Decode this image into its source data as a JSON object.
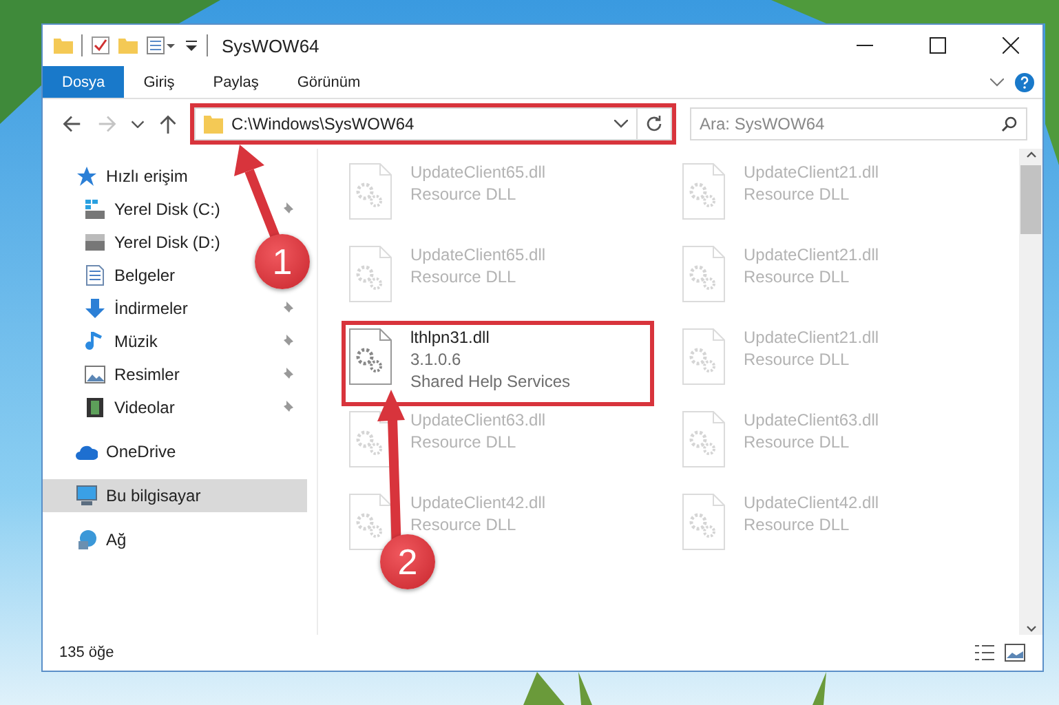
{
  "window": {
    "title": "SysWOW64"
  },
  "ribbon_tabs": [
    {
      "label": "Dosya",
      "selected": true
    },
    {
      "label": "Giriş",
      "selected": false
    },
    {
      "label": "Paylaş",
      "selected": false
    },
    {
      "label": "Görünüm",
      "selected": false
    }
  ],
  "nav_buttons": [
    {
      "kind": "back",
      "disabled": false
    },
    {
      "kind": "forward",
      "disabled": true
    },
    {
      "kind": "recent",
      "disabled": false
    },
    {
      "kind": "up",
      "disabled": false
    }
  ],
  "address_bar": {
    "value": "C:\\Windows\\SysWOW64",
    "highlighted": true
  },
  "search": {
    "placeholder": "Ara: SysWOW64"
  },
  "sidebar": {
    "items": [
      {
        "label": "Hızlı erişim",
        "kind": "quick",
        "selected": false,
        "children": [
          {
            "label": "Yerel Disk (C:)",
            "kind": "system-drive",
            "pinned": true,
            "selected": false
          },
          {
            "label": "Yerel Disk (D:)",
            "kind": "drive",
            "selected": false
          },
          {
            "label": "Belgeler",
            "kind": "documents",
            "selected": false
          },
          {
            "label": "İndirmeler",
            "kind": "downloads",
            "pinned": true,
            "selected": false
          },
          {
            "label": "Müzik",
            "kind": "music",
            "pinned": true,
            "selected": false
          },
          {
            "label": "Resimler",
            "kind": "pictures",
            "pinned": true,
            "selected": false
          },
          {
            "label": "Videolar",
            "kind": "videos",
            "pinned": true,
            "selected": false
          }
        ]
      },
      {
        "label": "OneDrive",
        "kind": "cloud",
        "selected": false
      },
      {
        "label": "Bu bilgisayar",
        "kind": "computer",
        "selected": true
      },
      {
        "label": "Ağ",
        "kind": "network",
        "selected": false
      }
    ]
  },
  "files": [
    {
      "name": "UpdateClient65.dll",
      "details": [
        "Resource DLL"
      ],
      "dimmed": true,
      "highlighted": false
    },
    {
      "name": "UpdateClient21.dll",
      "details": [
        "Resource DLL"
      ],
      "dimmed": true,
      "highlighted": false
    },
    {
      "name": "UpdateClient65.dll",
      "details": [
        "Resource DLL"
      ],
      "dimmed": true,
      "highlighted": false
    },
    {
      "name": "UpdateClient21.dll",
      "details": [
        "Resource DLL"
      ],
      "dimmed": true,
      "highlighted": false
    },
    {
      "name": "lthlpn31.dll",
      "details": [
        "3.1.0.6",
        "Shared Help Services"
      ],
      "dimmed": false,
      "highlighted": true
    },
    {
      "name": "UpdateClient21.dll",
      "details": [
        "Resource DLL"
      ],
      "dimmed": true,
      "highlighted": false
    },
    {
      "name": "UpdateClient63.dll",
      "details": [
        "Resource DLL"
      ],
      "dimmed": true,
      "highlighted": false
    },
    {
      "name": "UpdateClient63.dll",
      "details": [
        "Resource DLL"
      ],
      "dimmed": true,
      "highlighted": false
    },
    {
      "name": "UpdateClient42.dll",
      "details": [
        "Resource DLL"
      ],
      "dimmed": true,
      "highlighted": false
    },
    {
      "name": "UpdateClient42.dll",
      "details": [
        "Resource DLL"
      ],
      "dimmed": true,
      "highlighted": false
    }
  ],
  "status_bar": {
    "item_count": "135 öğe"
  },
  "annotations": [
    {
      "number": "1"
    },
    {
      "number": "2"
    }
  ]
}
